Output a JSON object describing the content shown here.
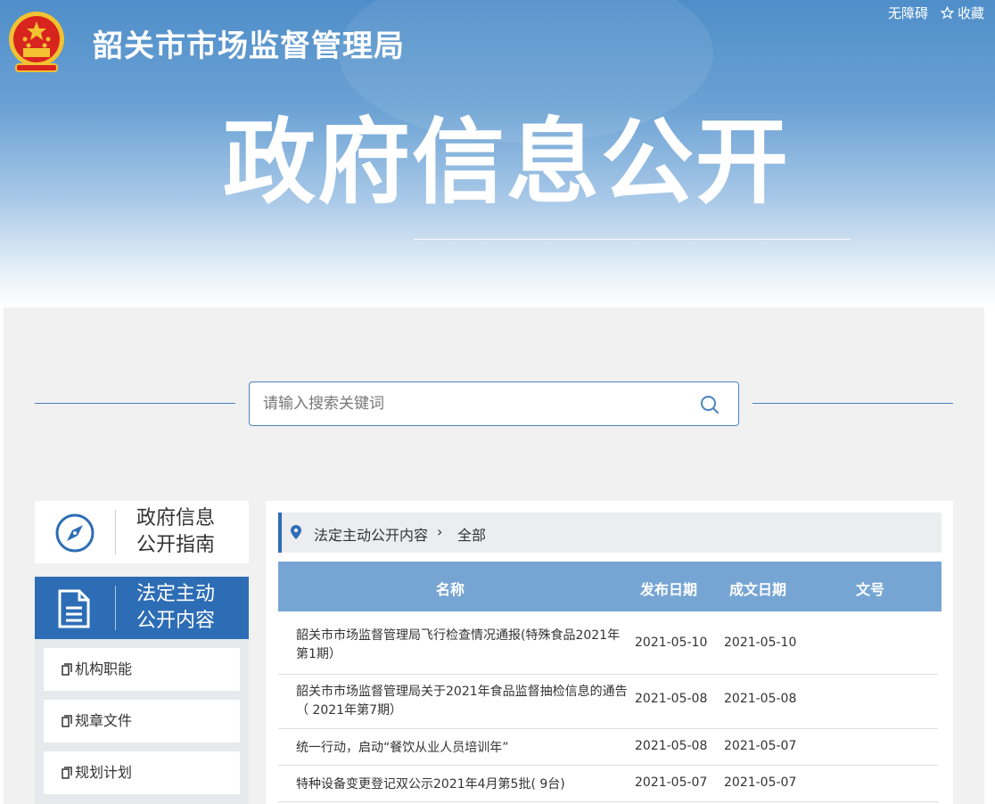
{
  "header": {
    "site_title": "韶关市市场监督管理局",
    "big_title": "政府信息公开",
    "accessibility_link": "无障碍",
    "favorite_link": "收藏"
  },
  "search": {
    "placeholder": "请输入搜索关键词"
  },
  "nav": {
    "guide_line1": "政府信息",
    "guide_line2": "公开指南",
    "active_line1": "法定主动",
    "active_line2": "公开内容",
    "sub_items": [
      "机构职能",
      "规章文件",
      "规划计划"
    ]
  },
  "breadcrumb": {
    "section": "法定主动公开内容",
    "current": "全部"
  },
  "table": {
    "headers": [
      "名称",
      "发布日期",
      "成文日期",
      "文号"
    ],
    "rows": [
      {
        "name": "韶关市市场监督管理局飞行检查情况通报(特殊食品2021年第1期）",
        "publish": "2021-05-10",
        "written": "2021-05-10"
      },
      {
        "name": "韶关市市场监督管理局关于2021年食品监督抽检信息的通告（ 2021年第7期）",
        "publish": "2021-05-08",
        "written": "2021-05-08"
      },
      {
        "name": "统一行动，启动“餐饮从业人员培训年”",
        "publish": "2021-05-08",
        "written": "2021-05-07"
      },
      {
        "name": "特种设备变更登记双公示2021年4月第5批( 9台)",
        "publish": "2021-05-07",
        "written": "2021-05-07"
      }
    ]
  },
  "colors": {
    "primary": "#2d6db5",
    "table_header": "#77a5d3",
    "main_bg": "#f1f1f1"
  }
}
